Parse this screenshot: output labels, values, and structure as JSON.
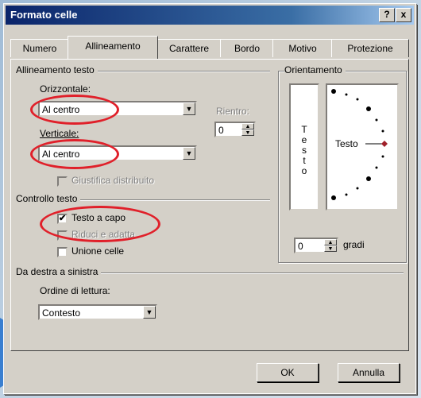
{
  "window": {
    "title": "Formato celle",
    "help_label": "?",
    "close_label": "x"
  },
  "tabs": [
    {
      "label": "Numero"
    },
    {
      "label": "Allineamento"
    },
    {
      "label": "Carattere"
    },
    {
      "label": "Bordo"
    },
    {
      "label": "Motivo"
    },
    {
      "label": "Protezione"
    }
  ],
  "active_tab": "Allineamento",
  "alignment": {
    "section": "Allineamento testo",
    "horizontal_label": "Orizzontale:",
    "horizontal_value": "Al centro",
    "vertical_label": "Verticale:",
    "vertical_value": "Al centro",
    "indent_label": "Rientro:",
    "indent_value": "0",
    "justify_distributed": "Giustifica distribuito"
  },
  "text_control": {
    "section": "Controllo testo",
    "wrap_text": "Testo a capo",
    "shrink_to_fit": "Riduci e adatta",
    "merge_cells": "Unione celle"
  },
  "orientation": {
    "section": "Orientamento",
    "vertical_text": [
      "T",
      "e",
      "s",
      "t",
      "o"
    ],
    "dial_text": "Testo",
    "degrees_value": "0",
    "degrees_label": "gradi"
  },
  "rtl": {
    "section": "Da destra a sinistra",
    "reading_order_label": "Ordine di lettura:",
    "reading_order_value": "Contesto"
  },
  "buttons": {
    "ok": "OK",
    "cancel": "Annulla"
  },
  "colors": {
    "title_bar": "#0a246a",
    "highlight_circle": "#e0202a",
    "arrow": "#3a7fd0",
    "dial_dots": "#000000",
    "dial_marker": "#a0202a"
  }
}
